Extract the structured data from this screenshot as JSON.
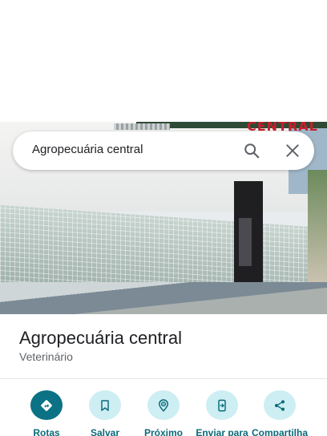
{
  "search": {
    "query": "Agropecuária central"
  },
  "photo": {
    "sign_text": "CENTRAL"
  },
  "place": {
    "name": "Agropecuária central",
    "category": "Veterinário"
  },
  "actions": [
    {
      "label": "Rotas",
      "icon": "directions-icon",
      "primary": true
    },
    {
      "label": "Salvar",
      "icon": "bookmark-icon",
      "primary": false
    },
    {
      "label": "Próximo",
      "icon": "nearby-icon",
      "primary": false
    },
    {
      "label": "Enviar para",
      "icon": "send-to-phone-icon",
      "primary": false
    },
    {
      "label": "Compartilha",
      "icon": "share-icon",
      "primary": false
    }
  ],
  "colors": {
    "accent": "#0b7285",
    "accent_light": "#cdeef3",
    "label": "#0b6a7a"
  }
}
